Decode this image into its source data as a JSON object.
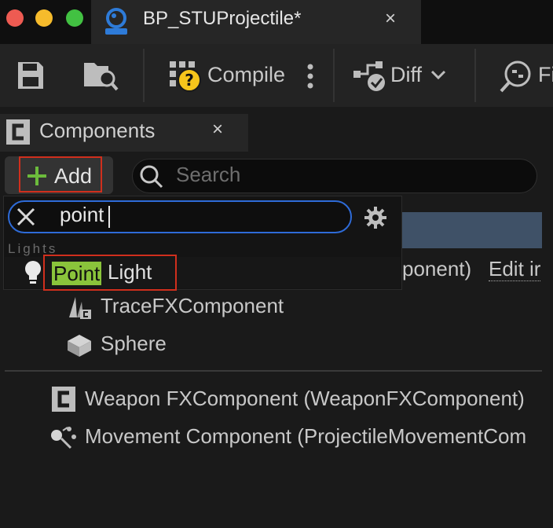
{
  "window": {
    "tab_title": "BP_STUProjectile*",
    "tab_close": "×",
    "traffic_lights": [
      "#ee5b52",
      "#f6bb2c",
      "#42c142"
    ]
  },
  "toolbar": {
    "save_icon": "save-icon",
    "browse_icon": "browse-icon",
    "compile_label": "Compile",
    "diff_label": "Diff",
    "find_label": "Fi"
  },
  "components_panel": {
    "title": "Components",
    "close": "×",
    "add_label": "Add",
    "search_placeholder": "Search"
  },
  "tree": {
    "partial_row_suffix": "ponent)",
    "partial_link": "Edit ir",
    "items": [
      {
        "label": "TraceFXComponent",
        "icon": "niagara-icon"
      },
      {
        "label": "Sphere",
        "icon": "sphere-mesh-icon"
      }
    ],
    "root_items": [
      {
        "label": "Weapon FXComponent (WeaponFXComponent)",
        "icon": "component-c-icon"
      },
      {
        "label": "Movement Component (ProjectileMovementCom",
        "icon": "movement-icon"
      }
    ]
  },
  "dropdown": {
    "filter_value": "point",
    "category": "Lights",
    "result_match": "Point",
    "result_rest": "Light"
  },
  "colors": {
    "accent_blue": "#2e6bd8",
    "highlight_red": "#d02f1d",
    "match_green": "#8ac43b",
    "selected_row": "#3f5167"
  }
}
